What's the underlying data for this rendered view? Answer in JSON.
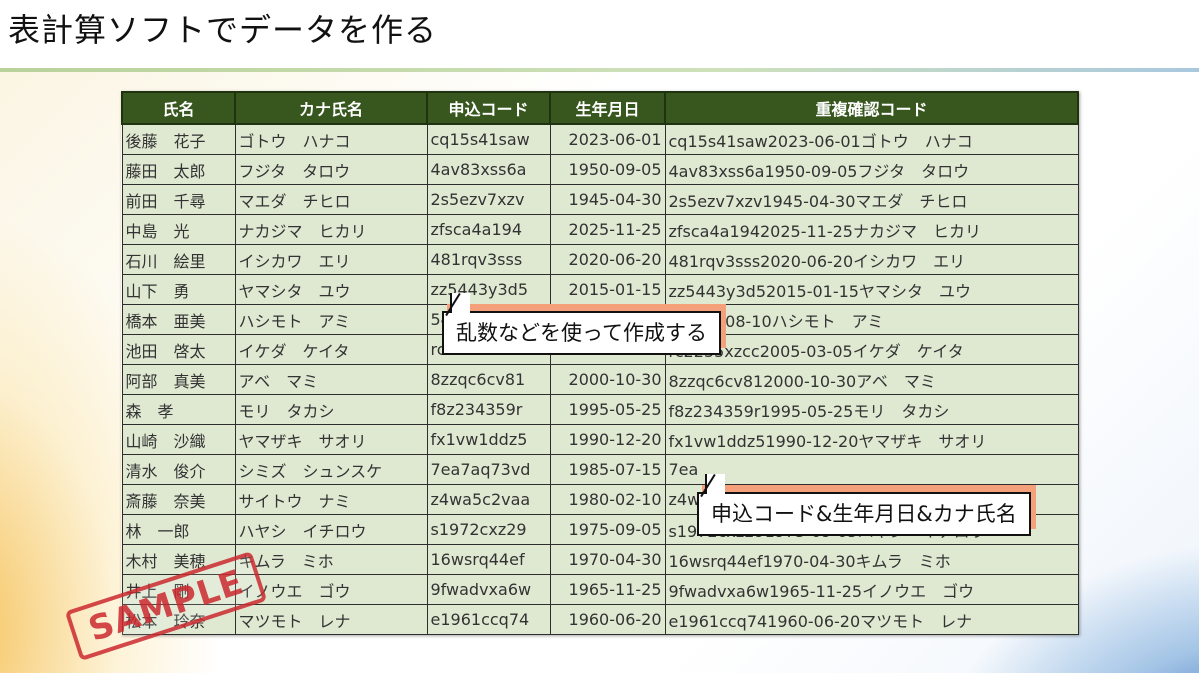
{
  "slide": {
    "title": "表計算ソフトでデータを作る"
  },
  "table": {
    "headers": [
      "氏名",
      "カナ氏名",
      "申込コード",
      "生年月日",
      "重複確認コード"
    ],
    "rows": [
      [
        "後藤　花子",
        "ゴトウ　ハナコ",
        "cq15s41saw",
        "2023-06-01",
        "cq15s41saw2023-06-01ゴトウ　ハナコ"
      ],
      [
        "藤田　太郎",
        "フジタ　タロウ",
        "4av83xss6a",
        "1950-09-05",
        "4av83xss6a1950-09-05フジタ　タロウ"
      ],
      [
        "前田　千尋",
        "マエダ　チヒロ",
        "2s5ezv7xzv",
        "1945-04-30",
        "2s5ezv7xzv1945-04-30マエダ　チヒロ"
      ],
      [
        "中島　光",
        "ナカジマ　ヒカリ",
        "zfsca4a194",
        "2025-11-25",
        "zfsca4a1942025-11-25ナカジマ　ヒカリ"
      ],
      [
        "石川　絵里",
        "イシカワ　エリ",
        "481rqv3sss",
        "2020-06-20",
        "481rqv3sss2020-06-20イシカワ　エリ"
      ],
      [
        "山下　勇",
        "ヤマシタ　ユウ",
        "zz5443y3d5",
        "2015-01-15",
        "zz5443y3d52015-01-15ヤマシタ　ユウ"
      ],
      [
        "橋本　亜美",
        "ハシモト　アミ",
        "54",
        "",
        "42010-08-10ハシモト　アミ"
      ],
      [
        "池田　啓太",
        "イケダ　ケイタ",
        "rc2235xzcc",
        "2005-03-05",
        "rc2235xzcc2005-03-05イケダ　ケイタ"
      ],
      [
        "阿部　真美",
        "アベ　マミ",
        "8zzqc6cv81",
        "2000-10-30",
        "8zzqc6cv812000-10-30アベ　マミ"
      ],
      [
        "森　孝",
        "モリ　タカシ",
        "f8z234359r",
        "1995-05-25",
        "f8z234359r1995-05-25モリ　タカシ"
      ],
      [
        "山崎　沙織",
        "ヤマザキ　サオリ",
        "fx1vw1ddz5",
        "1990-12-20",
        "fx1vw1ddz51990-12-20ヤマザキ　サオリ"
      ],
      [
        "清水　俊介",
        "シミズ　シュンスケ",
        "7ea7aq73vd",
        "1985-07-15",
        "7ea"
      ],
      [
        "斎藤　奈美",
        "サイトウ　ナミ",
        "z4wa5c2vaa",
        "1980-02-10",
        "z4w"
      ],
      [
        "林　一郎",
        "ハヤシ　イチロウ",
        "s1972cxz29",
        "1975-09-05",
        "s1972cxz291975-09-05ハヤシ　イチロウ"
      ],
      [
        "木村　美穂",
        "キムラ　ミホ",
        "16wsrq44ef",
        "1970-04-30",
        "16wsrq44ef1970-04-30キムラ　ミホ"
      ],
      [
        "井上　剛",
        "イノウエ　ゴウ",
        "9fwadvxa6w",
        "1965-11-25",
        "9fwadvxa6w1965-11-25イノウエ　ゴウ"
      ],
      [
        "松本　玲奈",
        "マツモト　レナ",
        "e1961ccq74",
        "1960-06-20",
        "e1961ccq741960-06-20マツモト　レナ"
      ]
    ]
  },
  "callouts": {
    "random": "乱数などを使って作成する",
    "concat": "申込コード&生年月日&カナ氏名"
  },
  "stamp": {
    "text": "SAMPLE"
  },
  "colors": {
    "header_bg": "#38571f",
    "cell_bg": "#dfe9d2",
    "callout_shadow": "#f4a07a",
    "stamp": "#cc2a30"
  }
}
